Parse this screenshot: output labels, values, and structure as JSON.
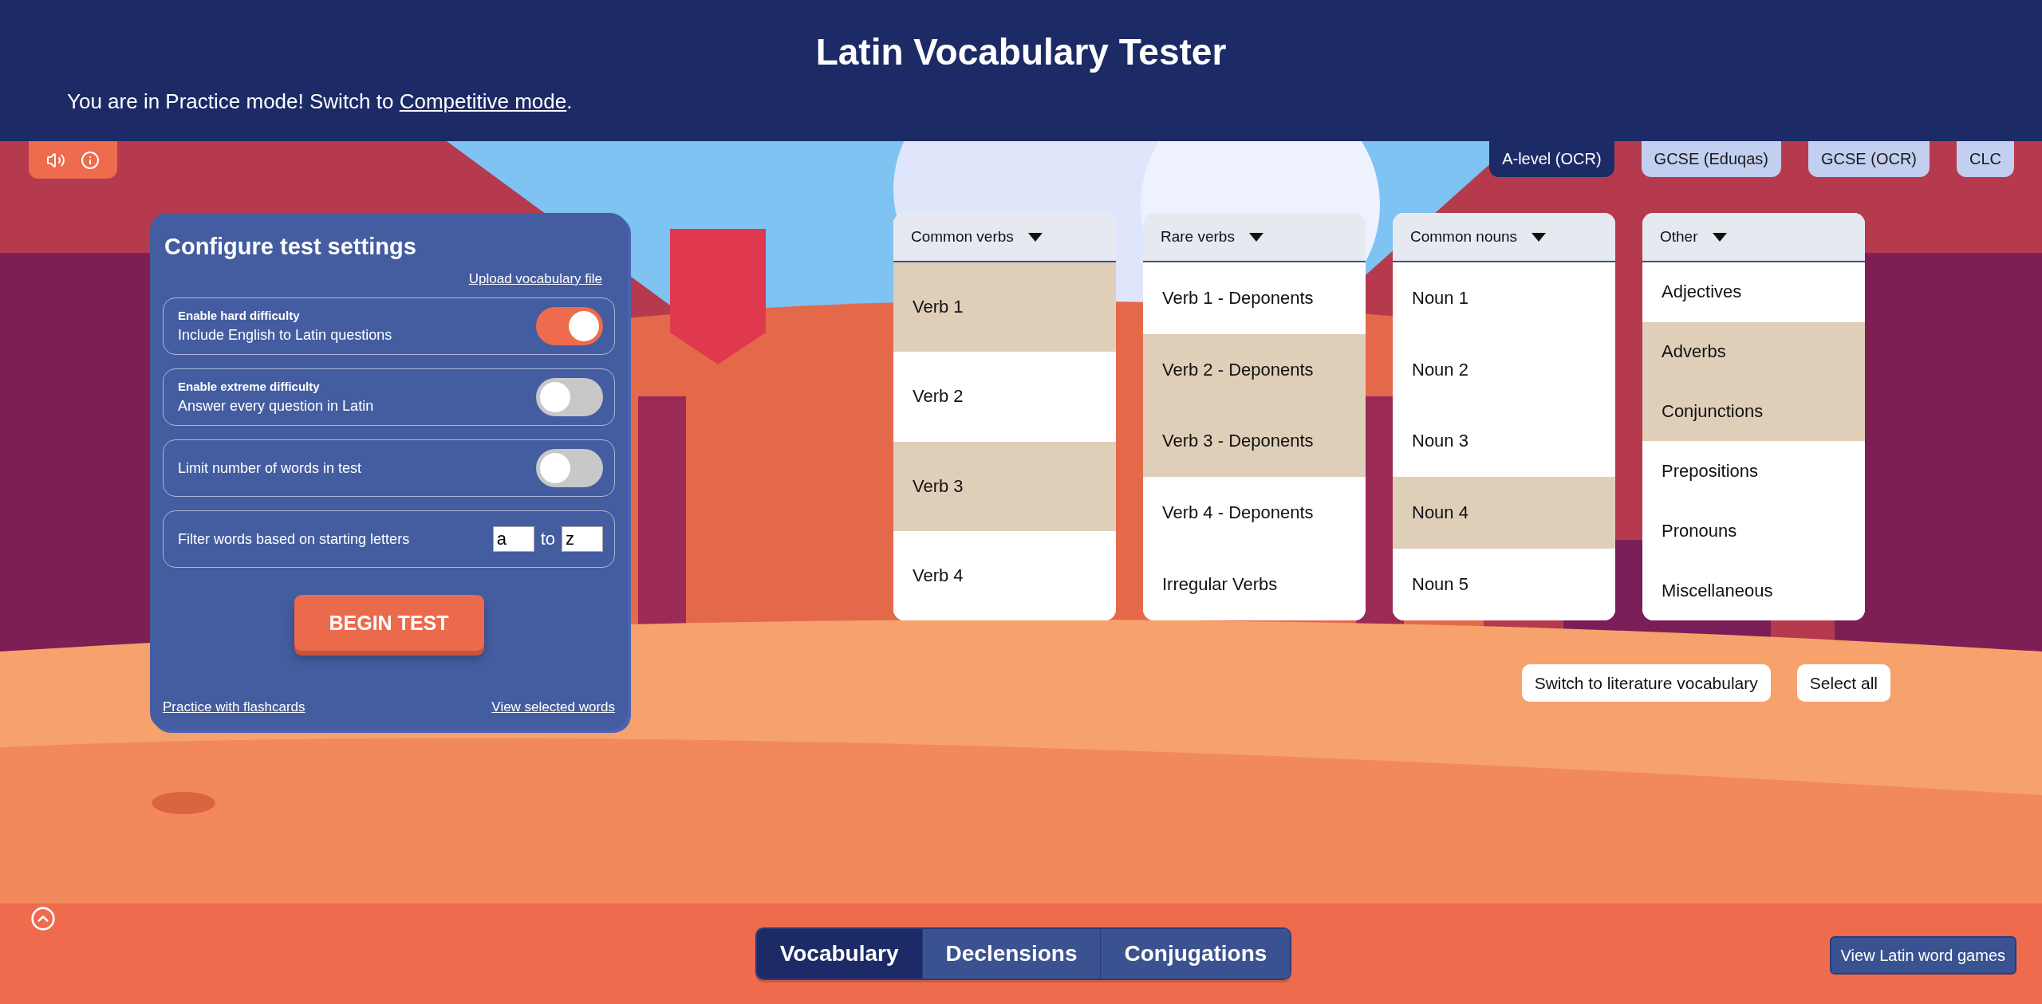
{
  "header": {
    "title": "Latin Vocabulary Tester",
    "notice": {
      "before": "You are in Practice mode! Switch to ",
      "link": "Competitive mode",
      "after": "."
    }
  },
  "exam_tabs": [
    {
      "label": "A-level (OCR)",
      "selected": true
    },
    {
      "label": "GCSE (Eduqas)",
      "selected": false
    },
    {
      "label": "GCSE (OCR)",
      "selected": false
    },
    {
      "label": "CLC",
      "selected": false
    }
  ],
  "settings": {
    "title": "Configure test settings",
    "upload_link": "Upload vocabulary file",
    "options": [
      {
        "kind": "toggle",
        "title": "Enable hard difficulty",
        "description": "Include English to Latin questions",
        "on": true
      },
      {
        "kind": "toggle",
        "title": "Enable extreme difficulty",
        "description": "Answer every question in Latin",
        "on": false
      },
      {
        "kind": "toggle",
        "description": "Limit number of words in test",
        "on": false
      },
      {
        "kind": "range",
        "description": "Filter words based on starting letters",
        "from": "a",
        "separator": "to",
        "to": "z"
      }
    ],
    "begin_button": "BEGIN TEST",
    "flashcards_link": "Practice with flashcards",
    "view_link": "View selected words"
  },
  "categories": [
    {
      "title": "Common verbs",
      "items": [
        {
          "label": "Verb 1",
          "selected": true
        },
        {
          "label": "Verb 2",
          "selected": false
        },
        {
          "label": "Verb 3",
          "selected": true
        },
        {
          "label": "Verb 4",
          "selected": false
        }
      ]
    },
    {
      "title": "Rare verbs",
      "items": [
        {
          "label": "Verb 1 - Deponents",
          "selected": false
        },
        {
          "label": "Verb 2 - Deponents",
          "selected": true
        },
        {
          "label": "Verb 3 - Deponents",
          "selected": true
        },
        {
          "label": "Verb 4 - Deponents",
          "selected": false
        },
        {
          "label": "Irregular Verbs",
          "selected": false
        }
      ]
    },
    {
      "title": "Common nouns",
      "items": [
        {
          "label": "Noun 1",
          "selected": false
        },
        {
          "label": "Noun 2",
          "selected": false
        },
        {
          "label": "Noun 3",
          "selected": false
        },
        {
          "label": "Noun 4",
          "selected": true
        },
        {
          "label": "Noun 5",
          "selected": false
        }
      ]
    },
    {
      "title": "Other",
      "items": [
        {
          "label": "Adjectives",
          "selected": false
        },
        {
          "label": "Adverbs",
          "selected": true
        },
        {
          "label": "Conjunctions",
          "selected": true
        },
        {
          "label": "Prepositions",
          "selected": false
        },
        {
          "label": "Pronouns",
          "selected": false
        },
        {
          "label": "Miscellaneous",
          "selected": false
        }
      ]
    }
  ],
  "actions": [
    "Switch to literature vocabulary",
    "Select all"
  ],
  "mode_tabs": [
    {
      "label": "Vocabulary",
      "selected": true
    },
    {
      "label": "Declensions",
      "selected": false
    },
    {
      "label": "Conjugations",
      "selected": false
    }
  ],
  "games_button": "View Latin word games"
}
